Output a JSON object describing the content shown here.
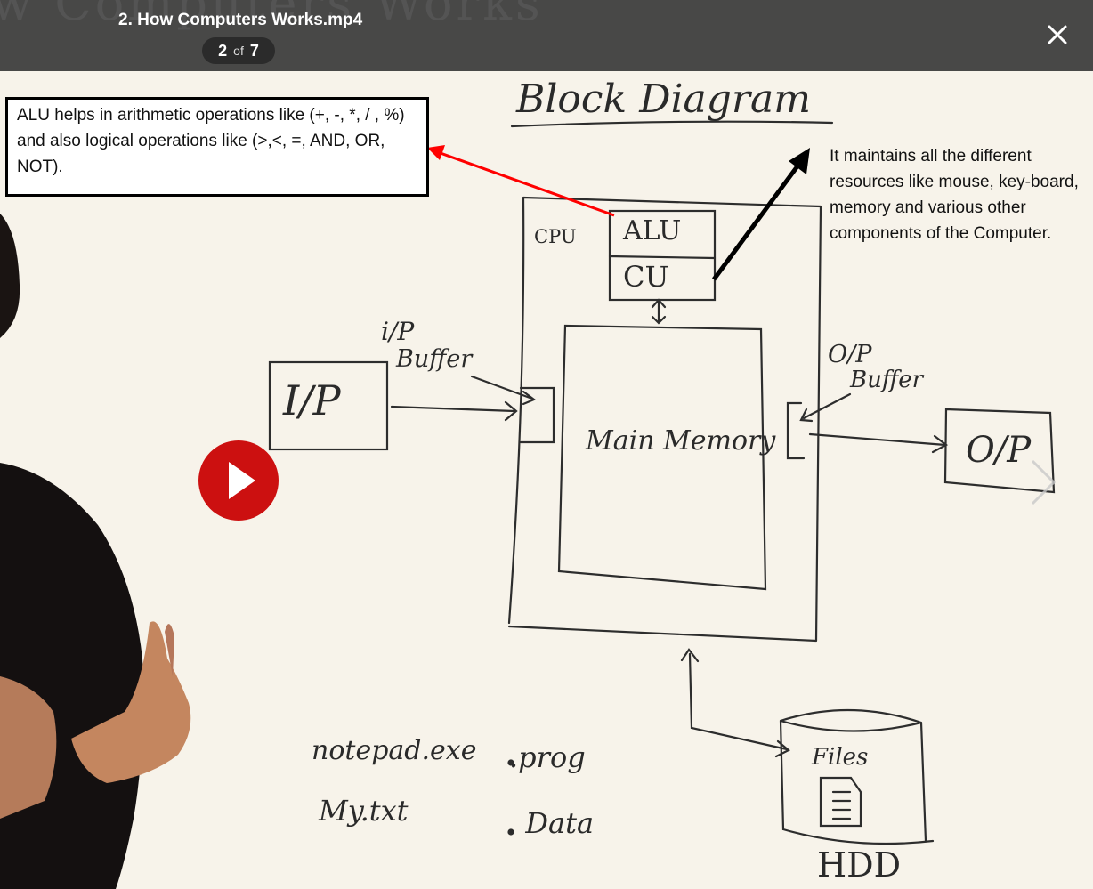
{
  "header": {
    "faded_title": "w Computers Works",
    "file_title": "2. How Computers Works.mp4",
    "counter_current": "2",
    "counter_of": "of",
    "counter_total": "7"
  },
  "callouts": {
    "alu_note": "ALU helps in arithmetic operations like (+, -, *, / , %) and also logical operations like (>,<, =, AND, OR, NOT).",
    "cu_note": "It maintains all the different resources like mouse, key-board, memory and various other components of the Computer."
  },
  "whiteboard": {
    "heading": "Block Diagram",
    "cpu_label": "CPU",
    "alu_label": "ALU",
    "cu_label": "CU",
    "input_label": "I/P",
    "input_buffer_line1": "i/P",
    "input_buffer_line2": "Buffer",
    "main_memory_label": "Main Memory",
    "output_buffer_line1": "O/P",
    "output_buffer_line2": "Buffer",
    "output_label": "O/P",
    "files_label": "Files",
    "hdd_label": "HDD",
    "file_examples": [
      "notepad.exe",
      "My.txt"
    ],
    "file_types": [
      ".prog",
      ". Data"
    ]
  },
  "colors": {
    "callout_arrow": "#ff0000",
    "play_button": "#cc1010",
    "topbar": "#3a3a3a"
  },
  "icons": {
    "close": "close-icon",
    "play": "play-icon",
    "next": "chevron-right-icon"
  }
}
